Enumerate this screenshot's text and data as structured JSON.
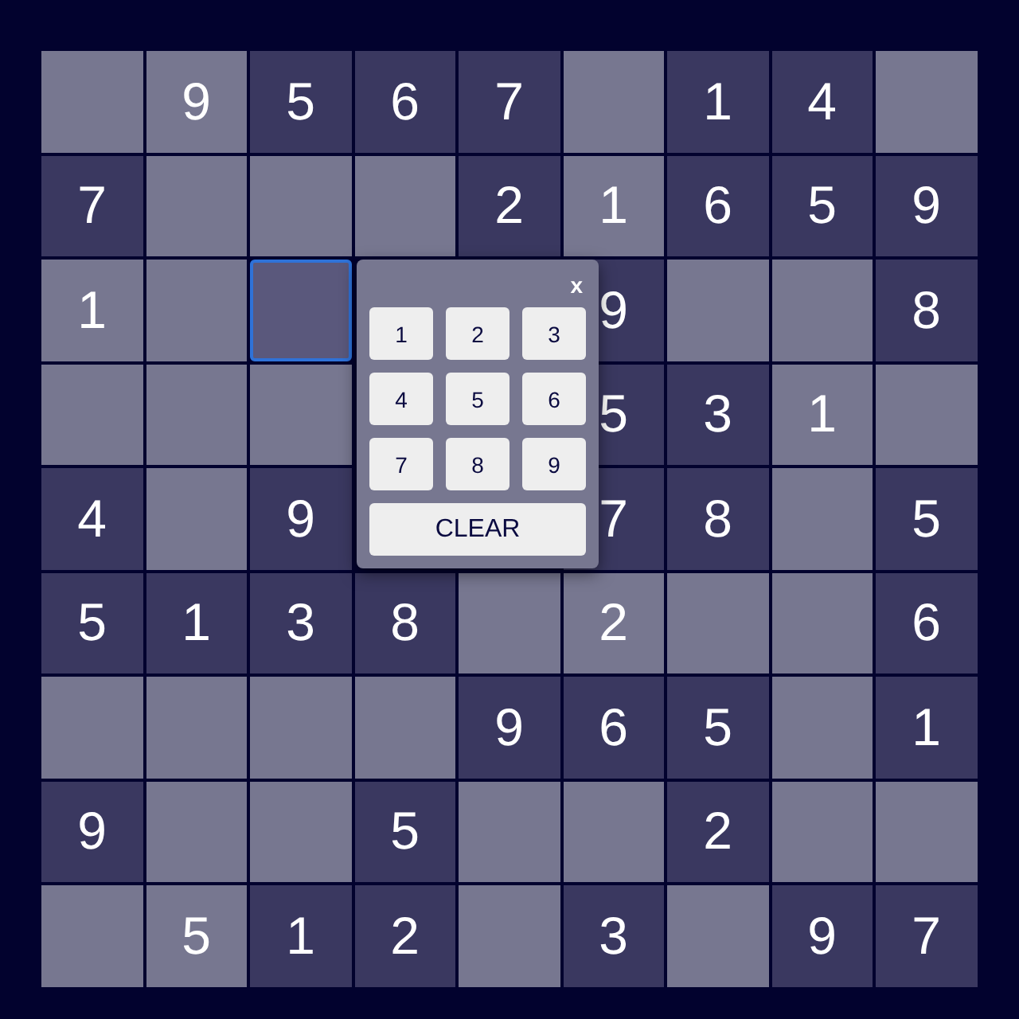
{
  "grid": [
    [
      {
        "given": false,
        "selected": false
      },
      {
        "value": "9",
        "given": false,
        "selected": false
      },
      {
        "value": "5",
        "given": true,
        "selected": false
      },
      {
        "value": "6",
        "given": true,
        "selected": false
      },
      {
        "value": "7",
        "given": true,
        "selected": false
      },
      {
        "given": false,
        "selected": false
      },
      {
        "value": "1",
        "given": true,
        "selected": false
      },
      {
        "value": "4",
        "given": true,
        "selected": false
      },
      {
        "given": false,
        "selected": false
      }
    ],
    [
      {
        "value": "7",
        "given": true,
        "selected": false
      },
      {
        "given": false,
        "selected": false
      },
      {
        "given": false,
        "selected": false
      },
      {
        "given": false,
        "selected": false
      },
      {
        "value": "2",
        "given": true,
        "selected": false
      },
      {
        "value": "1",
        "given": false,
        "selected": false
      },
      {
        "value": "6",
        "given": true,
        "selected": false
      },
      {
        "value": "5",
        "given": true,
        "selected": false
      },
      {
        "value": "9",
        "given": true,
        "selected": false
      }
    ],
    [
      {
        "value": "1",
        "given": false,
        "selected": false
      },
      {
        "given": false,
        "selected": false
      },
      {
        "given": false,
        "selected": true
      },
      {
        "value": "9",
        "given": true,
        "selected": false
      },
      {
        "given": false,
        "selected": false
      },
      {
        "given": false,
        "selected": false
      },
      {
        "value": "8",
        "given": true,
        "selected": false
      }
    ],
    [
      {
        "given": false,
        "selected": false
      },
      {
        "given": false,
        "selected": false
      },
      {
        "given": false,
        "selected": false
      },
      {
        "value": "5",
        "given": true,
        "selected": false
      },
      {
        "value": "3",
        "given": true,
        "selected": false
      },
      {
        "value": "1",
        "given": false,
        "selected": false
      },
      {
        "given": false,
        "selected": false
      }
    ],
    [
      {
        "value": "4",
        "given": true,
        "selected": false
      },
      {
        "given": false,
        "selected": false
      },
      {
        "value": "9",
        "given": true,
        "selected": false
      },
      {
        "value": "7",
        "given": true,
        "selected": false
      },
      {
        "value": "8",
        "given": true,
        "selected": false
      },
      {
        "given": false,
        "selected": false
      },
      {
        "value": "5",
        "given": true,
        "selected": false
      }
    ],
    [
      {
        "value": "5",
        "given": true,
        "selected": false
      },
      {
        "value": "1",
        "given": true,
        "selected": false
      },
      {
        "value": "3",
        "given": true,
        "selected": false
      },
      {
        "value": "8",
        "given": true,
        "selected": false
      },
      {
        "given": false,
        "selected": false
      },
      {
        "value": "2",
        "given": false,
        "selected": false
      },
      {
        "given": false,
        "selected": false
      },
      {
        "given": false,
        "selected": false
      },
      {
        "value": "6",
        "given": true,
        "selected": false
      }
    ],
    [
      {
        "given": false,
        "selected": false
      },
      {
        "given": false,
        "selected": false
      },
      {
        "given": false,
        "selected": false
      },
      {
        "given": false,
        "selected": false
      },
      {
        "value": "9",
        "given": true,
        "selected": false
      },
      {
        "value": "6",
        "given": true,
        "selected": false
      },
      {
        "value": "5",
        "given": true,
        "selected": false
      },
      {
        "given": false,
        "selected": false
      },
      {
        "value": "1",
        "given": true,
        "selected": false
      }
    ],
    [
      {
        "value": "9",
        "given": true,
        "selected": false
      },
      {
        "given": false,
        "selected": false
      },
      {
        "given": false,
        "selected": false
      },
      {
        "value": "5",
        "given": true,
        "selected": false
      },
      {
        "given": false,
        "selected": false
      },
      {
        "given": false,
        "selected": false
      },
      {
        "value": "2",
        "given": true,
        "selected": false
      },
      {
        "given": false,
        "selected": false
      },
      {
        "given": false,
        "selected": false
      }
    ],
    [
      {
        "given": false,
        "selected": false
      },
      {
        "value": "5",
        "given": false,
        "selected": false
      },
      {
        "value": "1",
        "given": true,
        "selected": false
      },
      {
        "value": "2",
        "given": true,
        "selected": false
      },
      {
        "given": false,
        "selected": false
      },
      {
        "value": "3",
        "given": true,
        "selected": false
      },
      {
        "given": false,
        "selected": false
      },
      {
        "value": "9",
        "given": true,
        "selected": false
      },
      {
        "value": "7",
        "given": true,
        "selected": false
      }
    ]
  ],
  "number_picker": {
    "close": "x",
    "keys": [
      "1",
      "2",
      "3",
      "4",
      "5",
      "6",
      "7",
      "8",
      "9"
    ],
    "clear": "CLEAR"
  }
}
